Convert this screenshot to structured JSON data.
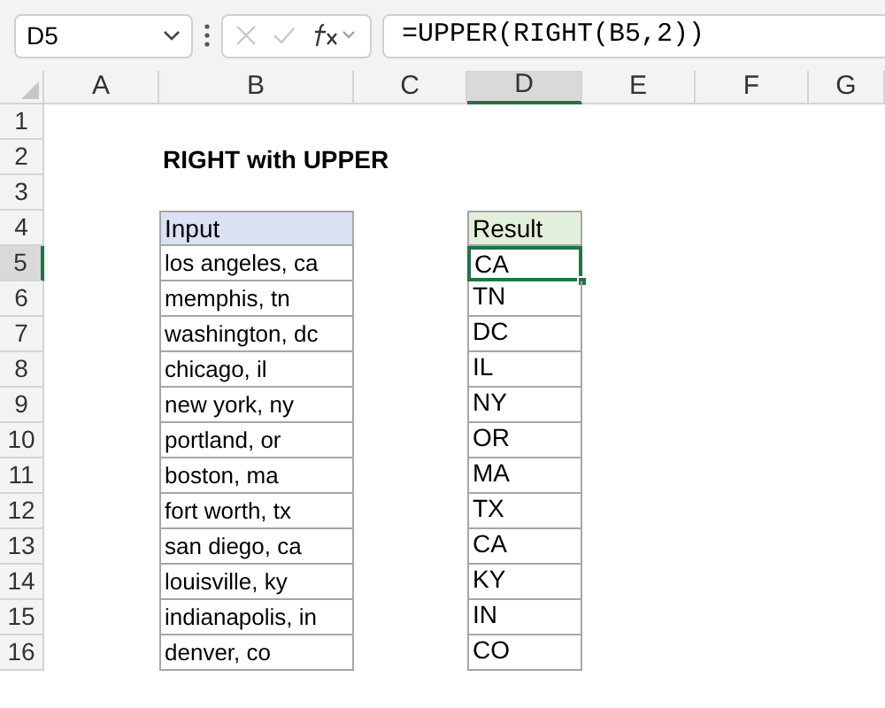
{
  "name_box": {
    "value": "D5"
  },
  "formula_bar": {
    "value": "=UPPER(RIGHT(B5,2))"
  },
  "columns": [
    {
      "label": "A",
      "selected": false
    },
    {
      "label": "B",
      "selected": false
    },
    {
      "label": "C",
      "selected": false
    },
    {
      "label": "D",
      "selected": true
    },
    {
      "label": "E",
      "selected": false
    },
    {
      "label": "F",
      "selected": false
    },
    {
      "label": "G",
      "selected": false
    }
  ],
  "rows": [
    {
      "label": "1",
      "selected": false
    },
    {
      "label": "2",
      "selected": false
    },
    {
      "label": "3",
      "selected": false
    },
    {
      "label": "4",
      "selected": false
    },
    {
      "label": "5",
      "selected": true
    },
    {
      "label": "6",
      "selected": false
    },
    {
      "label": "7",
      "selected": false
    },
    {
      "label": "8",
      "selected": false
    },
    {
      "label": "9",
      "selected": false
    },
    {
      "label": "10",
      "selected": false
    },
    {
      "label": "11",
      "selected": false
    },
    {
      "label": "12",
      "selected": false
    },
    {
      "label": "13",
      "selected": false
    },
    {
      "label": "14",
      "selected": false
    },
    {
      "label": "15",
      "selected": false
    },
    {
      "label": "16",
      "selected": false
    }
  ],
  "title": "RIGHT with UPPER",
  "table": {
    "input_header": "Input",
    "result_header": "Result",
    "rows": [
      {
        "input": "los angeles, ca",
        "result": "CA",
        "selected": true
      },
      {
        "input": "memphis, tn",
        "result": "TN",
        "selected": false
      },
      {
        "input": "washington, dc",
        "result": "DC",
        "selected": false
      },
      {
        "input": "chicago, il",
        "result": "IL",
        "selected": false
      },
      {
        "input": "new york, ny",
        "result": "NY",
        "selected": false
      },
      {
        "input": "portland, or",
        "result": "OR",
        "selected": false
      },
      {
        "input": "boston, ma",
        "result": "MA",
        "selected": false
      },
      {
        "input": "fort worth, tx",
        "result": "TX",
        "selected": false
      },
      {
        "input": "san diego, ca",
        "result": "CA",
        "selected": false
      },
      {
        "input": "louisville, ky",
        "result": "KY",
        "selected": false
      },
      {
        "input": "indianapolis, in",
        "result": "IN",
        "selected": false
      },
      {
        "input": "denver, co",
        "result": "CO",
        "selected": false
      }
    ]
  }
}
